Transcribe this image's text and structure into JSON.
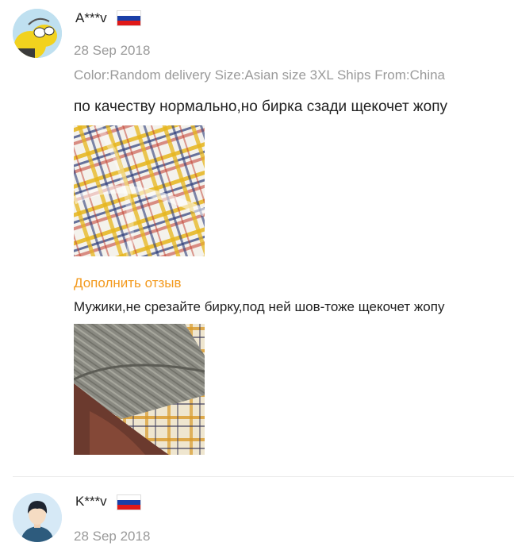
{
  "reviews": [
    {
      "username": "A***v",
      "country_flag": "russia-flag-icon",
      "date": "28 Sep 2018",
      "meta": "Color:Random delivery Size:Asian size 3XL Ships From:China",
      "text": "по качеству нормально,но бирка сзади щекочет жопу",
      "followup_label": "Дополнить отзыв",
      "followup_text": "Мужики,не срезайте бирку,под ней шов-тоже щекочет жопу"
    },
    {
      "username": "K***v",
      "country_flag": "russia-flag-icon",
      "date": "28 Sep 2018"
    }
  ],
  "colors": {
    "accent": "#f39a1e",
    "muted": "#9a9a9a",
    "text": "#222222",
    "flag_white": "#ffffff",
    "flag_blue": "#1a3fa8",
    "flag_red": "#e01818"
  }
}
